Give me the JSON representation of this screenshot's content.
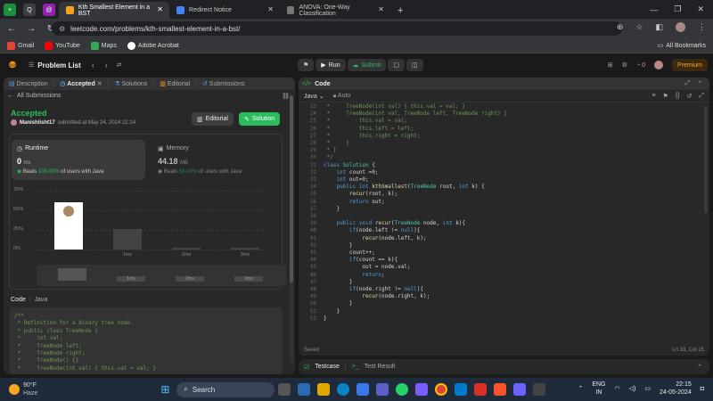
{
  "browser": {
    "tabs": [
      {
        "label": "Kth Smallest Element in a BST",
        "active": true
      },
      {
        "label": "Redirect Notice",
        "active": false
      },
      {
        "label": "ANOVA: One-Way Classification",
        "active": false
      }
    ],
    "new_tab": "+",
    "url": "leetcode.com/problems/kth-smallest-element-in-a-bst/",
    "bookmarks": [
      "Gmail",
      "YouTube",
      "Maps",
      "Adobe Acrobat"
    ],
    "all_bookmarks": "All Bookmarks"
  },
  "leetcode": {
    "problem_list": "Problem List",
    "run": "Run",
    "submit": "Submit",
    "streak": "0",
    "premium": "Premium"
  },
  "left": {
    "tabs": [
      "Description",
      "Accepted",
      "Solutions",
      "Editorial",
      "Submissions"
    ],
    "all_submissions": "All Submissions",
    "status": "Accepted",
    "user": "Manishlisht17",
    "submitted_text": "submitted at May 24, 2024 22:14",
    "editorial_btn": "Editorial",
    "solution_btn": "Solution",
    "runtime": {
      "title": "Runtime",
      "value": "0",
      "unit": "ms",
      "beats_prefix": "Beats",
      "beats_pct": "100.00%",
      "beats_suffix": "of users with Java"
    },
    "memory": {
      "title": "Memory",
      "value": "44.18",
      "unit": "MB",
      "beats_prefix": "Beats",
      "beats_pct": "56.99%",
      "beats_suffix": "of users with Java"
    },
    "code_label": "Code",
    "code_lang": "Java",
    "code_snippet": [
      "/**",
      " * Definition for a binary tree node.",
      " * public class TreeNode {",
      " *     int val;",
      " *     TreeNode left;",
      " *     TreeNode right;",
      " *     TreeNode() {}",
      " *     TreeNode(int val) { this.val = val; }"
    ]
  },
  "chart_data": {
    "type": "bar",
    "categories": [
      "",
      "1ms",
      "2ms",
      "3ms"
    ],
    "values": [
      60,
      26,
      2,
      2
    ],
    "ytick_labels": [
      "75%",
      "50%",
      "25%",
      "0%"
    ],
    "ylim": [
      0,
      75
    ],
    "mini_labels": [
      "1ms",
      "2ms",
      "3ms"
    ]
  },
  "right": {
    "header": "Code",
    "lang": "Java",
    "auto": "Auto",
    "saved": "Saved",
    "position": "Ln 33, Col 15",
    "start_line": 23,
    "lines": [
      " *     TreeNode(int val) { this.val = val; }",
      " *     TreeNode(int val, TreeNode left, TreeNode right) {",
      " *         this.val = val;",
      " *         this.left = left;",
      " *         this.right = right;",
      " *     }",
      " * }",
      " */",
      "class Solution {",
      "    int count =0;",
      "    int out=0;",
      "    public int kthSmallest(TreeNode root, int k) {",
      "        recur(root, k);",
      "        return out;",
      "    }",
      "",
      "    public void recur(TreeNode node, int k){",
      "        if(node.left != null){",
      "            recur(node.left, k);",
      "        }",
      "        count++;",
      "        if(count == k){",
      "            out = node.val;",
      "            return;",
      "        }",
      "        if(node.right != null){",
      "            recur(node.right, k);",
      "        }",
      "    }",
      "}"
    ],
    "testcase": "Testcase",
    "test_result": "Test Result"
  },
  "taskbar": {
    "weather_temp": "90°F",
    "weather_desc": "Haze",
    "search": "Search",
    "lang1": "ENG",
    "lang2": "IN",
    "time": "22:15",
    "date": "24-05-2024"
  },
  "colors": {
    "accent_green": "#2cbb5d",
    "premium": "#ffa116",
    "comment": "#6a9955",
    "keyword": "#569cd6",
    "type": "#4ec9b0",
    "func": "#dcdcaa"
  }
}
